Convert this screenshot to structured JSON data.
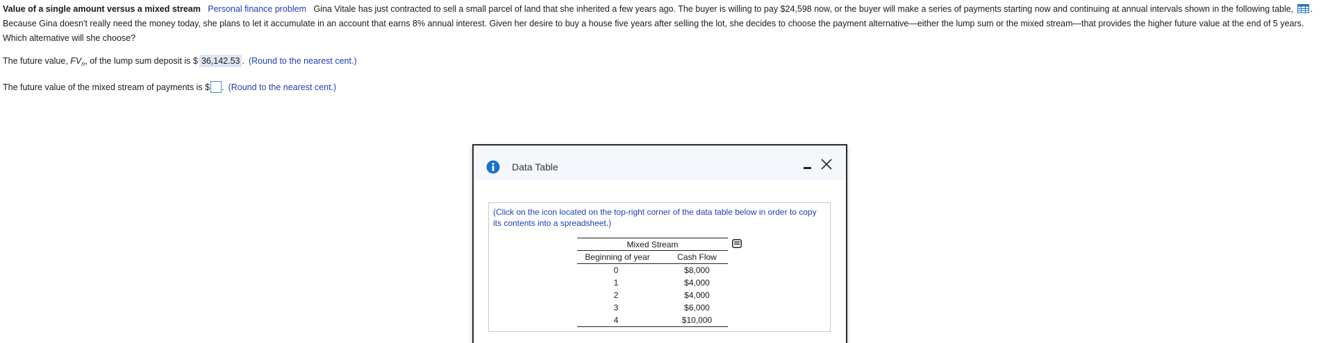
{
  "problem": {
    "title": "Value of a single amount versus a mixed stream",
    "category": "Personal finance problem",
    "text_before_icon": "Gina Vitale has just contracted to sell a small parcel of land that she inherited a few years ago.  The buyer is willing to pay $24,598 now, or the buyer will make  a series of payments starting now and continuing at annual intervals shown in the following table,",
    "text_after_icon": ". Because Gina doesn't really need the money today, she plans to let it accumulate in an account that earns 8% annual interest.  Given her desire to buy a house five years after selling the lot, she decides to choose the payment alternative—either the lump sum or the mixed stream—that provides the higher future value at the end of 5 years.  Which alternative will she choose?",
    "table_icon": "table-grid-icon"
  },
  "answers": {
    "lump_sum_prefix": "The future value, ",
    "fv_symbol": "FV",
    "fv_subscript": "n",
    "lump_sum_mid": ", of the lump sum deposit is $",
    "lump_sum_value": "36,142.53",
    "lump_sum_suffix": ".",
    "lump_sum_hint": "(Round to the nearest cent.)",
    "mixed_prefix": "The future value of the mixed stream of payments is $",
    "mixed_value": "",
    "mixed_suffix": ".",
    "mixed_hint": "(Round to the nearest cent.)"
  },
  "dialog": {
    "title": "Data Table",
    "note": "(Click on the icon located on the top-right corner of the data table below in order to copy its contents into a spreadsheet.)",
    "table_caption": "Mixed Stream",
    "col_year": "Beginning of year",
    "col_flow": "Cash Flow",
    "rows": [
      {
        "year": "0",
        "flow": "$8,000"
      },
      {
        "year": "1",
        "flow": "$4,000"
      },
      {
        "year": "2",
        "flow": "$4,000"
      },
      {
        "year": "3",
        "flow": "$6,000"
      },
      {
        "year": "4",
        "flow": "$10,000"
      }
    ]
  },
  "colors": {
    "link_blue": "#1f40b5",
    "filled_answer_bg": "#dde6f2",
    "info_blue": "#1a73c9",
    "header_bg": "#f4f7fc"
  }
}
